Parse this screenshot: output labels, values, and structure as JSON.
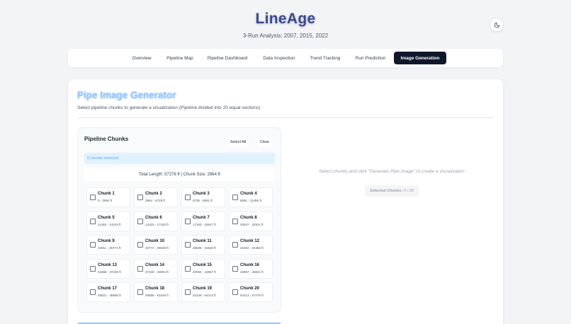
{
  "header": {
    "title": "LineAge",
    "subtitle": "3-Run Analysis: 2007, 2015, 2022",
    "theme_icon": "moon-icon"
  },
  "tabs": [
    {
      "label": "Overview"
    },
    {
      "label": "Pipeline Map"
    },
    {
      "label": "Pipeline Dashboard"
    },
    {
      "label": "Data Inspection"
    },
    {
      "label": "Trend Tracking"
    },
    {
      "label": "Run Prediction"
    },
    {
      "label": "Image Generation",
      "active": true
    }
  ],
  "generator": {
    "title": "Pipe Image Generator",
    "description": "Select pipeline chunks to generate a visualization (Pipeline divided into 20 equal sections)"
  },
  "chunks_panel": {
    "title": "Pipeline Chunks",
    "select_all_label": "Select All",
    "clear_label": "Clear",
    "selected_text": "0 chunks selected",
    "total_text": "Total Length: 57276 ft | Chunk Size: 2864 ft",
    "chunks": [
      {
        "name": "Chunk 1",
        "range": "0 - 2864 ft"
      },
      {
        "name": "Chunk 2",
        "range": "2864 - 5728 ft"
      },
      {
        "name": "Chunk 3",
        "range": "5728 - 8591 ft"
      },
      {
        "name": "Chunk 4",
        "range": "8591 - 11455 ft"
      },
      {
        "name": "Chunk 5",
        "range": "11455 - 14319 ft"
      },
      {
        "name": "Chunk 6",
        "range": "14319 - 17183 ft"
      },
      {
        "name": "Chunk 7",
        "range": "17183 - 20047 ft"
      },
      {
        "name": "Chunk 8",
        "range": "20047 - 22911 ft"
      },
      {
        "name": "Chunk 9",
        "range": "22911 - 25774 ft"
      },
      {
        "name": "Chunk 10",
        "range": "25774 - 28638 ft"
      },
      {
        "name": "Chunk 11",
        "range": "28638 - 31502 ft"
      },
      {
        "name": "Chunk 12",
        "range": "31502 - 34366 ft"
      },
      {
        "name": "Chunk 13",
        "range": "34366 - 37230 ft"
      },
      {
        "name": "Chunk 14",
        "range": "37230 - 40094 ft"
      },
      {
        "name": "Chunk 15",
        "range": "40094 - 42957 ft"
      },
      {
        "name": "Chunk 16",
        "range": "42957 - 45821 ft"
      },
      {
        "name": "Chunk 17",
        "range": "45821 - 48685 ft"
      },
      {
        "name": "Chunk 18",
        "range": "48685 - 51549 ft"
      },
      {
        "name": "Chunk 19",
        "range": "51549 - 54413 ft"
      },
      {
        "name": "Chunk 20",
        "range": "54413 - 57276 ft"
      }
    ]
  },
  "preview": {
    "hint": "Select chunks and click \"Generate Pipe Image\" to create a visualization",
    "selected_label": "Selected Chunks:",
    "selected_value": "0 / 20"
  }
}
